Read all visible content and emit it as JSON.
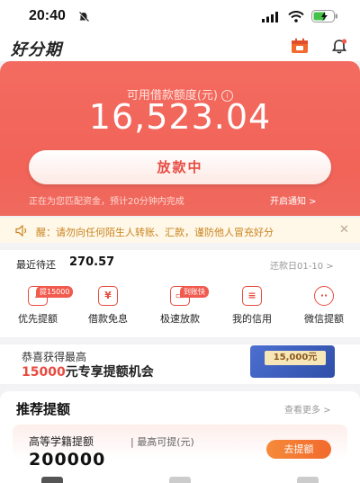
{
  "status_bar": {
    "time": "20:40"
  },
  "header": {
    "logo": "好分期"
  },
  "hero": {
    "label": "可用借款额度(元)",
    "amount": "16,523.04",
    "button_label": "放款中",
    "note": "正在为您匹配资金，预计20分钟内完成",
    "notify_label": "开启通知 >"
  },
  "notice": {
    "text": "醒：请勿向任何陌生人转账、汇款，谨防他人冒充好分"
  },
  "repay": {
    "label": "最近待还",
    "amount": "270.57",
    "date": "还款日01-10 >"
  },
  "quick_actions": [
    {
      "label": "优先提额",
      "badge": "提15000",
      "icon": "trending-up-icon"
    },
    {
      "label": "借款免息",
      "badge": "",
      "icon": "yuan-icon"
    },
    {
      "label": "极速放款",
      "badge": "到账快",
      "icon": "wallet-icon"
    },
    {
      "label": "我的信用",
      "badge": "",
      "icon": "document-icon"
    },
    {
      "label": "微信提额",
      "badge": "",
      "icon": "chat-icon"
    }
  ],
  "promo": {
    "line1": "恭喜获得最高",
    "highlight": "15000",
    "line2_rest": "元专享提额机会",
    "image_text": "15,000元"
  },
  "recommend": {
    "title": "推荐提额",
    "more": "查看更多 >",
    "card": {
      "label": "高等学籍提额",
      "sub": "| 最高可提(元)",
      "value": "200000",
      "button": "去提额"
    }
  },
  "colors": {
    "accent": "#f26358",
    "button_text": "#e84b40",
    "orange": "#f26a2e"
  }
}
